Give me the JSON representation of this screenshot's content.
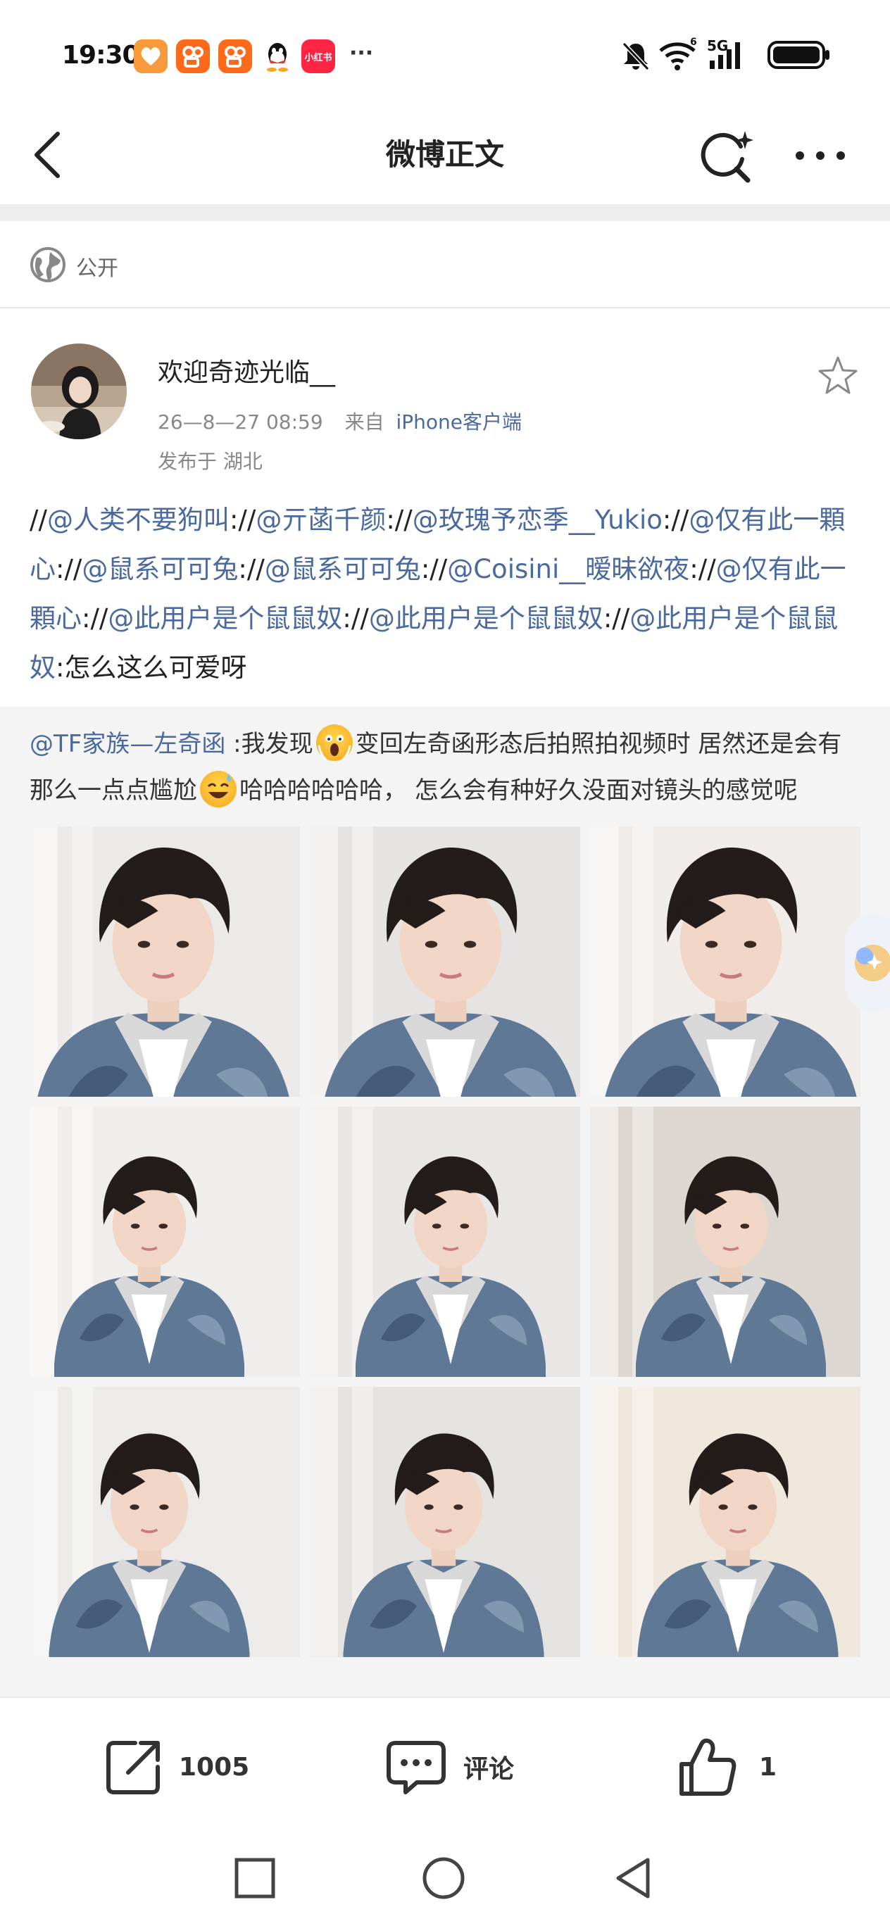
{
  "status_bar": {
    "time": "19:30",
    "app_icons": [
      "heart-app-icon",
      "kuaishou-icon",
      "kuaishou-icon",
      "qq-icon",
      "xiaohongshu-icon"
    ],
    "xiaohongshu_label": "小红书",
    "more": "···",
    "network": "5G",
    "wifi_badge": "6"
  },
  "header": {
    "title": "微博正文"
  },
  "visibility": {
    "label": "公开"
  },
  "author": {
    "name": "欢迎奇迹光临__",
    "date": "26—8—27  08:59",
    "from_prefix": "来自",
    "source": "iPhone客户端",
    "location": "发布于  湖北"
  },
  "repost": {
    "segments": [
      {
        "t": "//",
        "m": false
      },
      {
        "t": "@人类不要狗叫",
        "m": true
      },
      {
        "t": "://",
        "m": false
      },
      {
        "t": "@亓菡千颜",
        "m": true
      },
      {
        "t": "://",
        "m": false
      },
      {
        "t": "@玫瑰予恋季__Yukio",
        "m": true
      },
      {
        "t": "://",
        "m": false
      },
      {
        "t": "@仅有此一顆心",
        "m": true
      },
      {
        "t": "://",
        "m": false
      },
      {
        "t": "@鼠系可可兔",
        "m": true
      },
      {
        "t": "://",
        "m": false
      },
      {
        "t": "@鼠系可可兔",
        "m": true
      },
      {
        "t": "://",
        "m": false
      },
      {
        "t": "@Coisini__暧昧欲夜",
        "m": true
      },
      {
        "t": "://",
        "m": false
      },
      {
        "t": "@仅有此一顆心",
        "m": true
      },
      {
        "t": "://",
        "m": false
      },
      {
        "t": "@此用户是个鼠鼠奴",
        "m": true
      },
      {
        "t": "://",
        "m": false
      },
      {
        "t": "@此用户是个鼠鼠奴",
        "m": true
      },
      {
        "t": "://",
        "m": false
      },
      {
        "t": "@此用户是个鼠鼠奴",
        "m": true
      },
      {
        "t": ":怎么这么可爱呀",
        "m": false
      }
    ]
  },
  "original": {
    "mention": "@TF家族—左奇函",
    "part1": " :我发现",
    "emoji1": "scream-emoji",
    "part2": "变回左奇函形态后拍照拍视频时  居然还是会有那么一点点尴尬",
    "emoji2": "sweat-smile-emoji",
    "part3": "哈哈哈哈哈哈，  怎么会有种好久没面对镜头的感觉呢"
  },
  "photos": [
    {
      "name": "photo-1"
    },
    {
      "name": "photo-2"
    },
    {
      "name": "photo-3"
    },
    {
      "name": "photo-4"
    },
    {
      "name": "photo-5"
    },
    {
      "name": "photo-6"
    },
    {
      "name": "photo-7"
    },
    {
      "name": "photo-8"
    },
    {
      "name": "photo-9"
    }
  ],
  "actions": {
    "repost_count": "1005",
    "comment_label": "评论",
    "like_count": "1"
  },
  "colors": {
    "mention": "#4a6a9e",
    "background_gray": "#f4f4f4"
  }
}
